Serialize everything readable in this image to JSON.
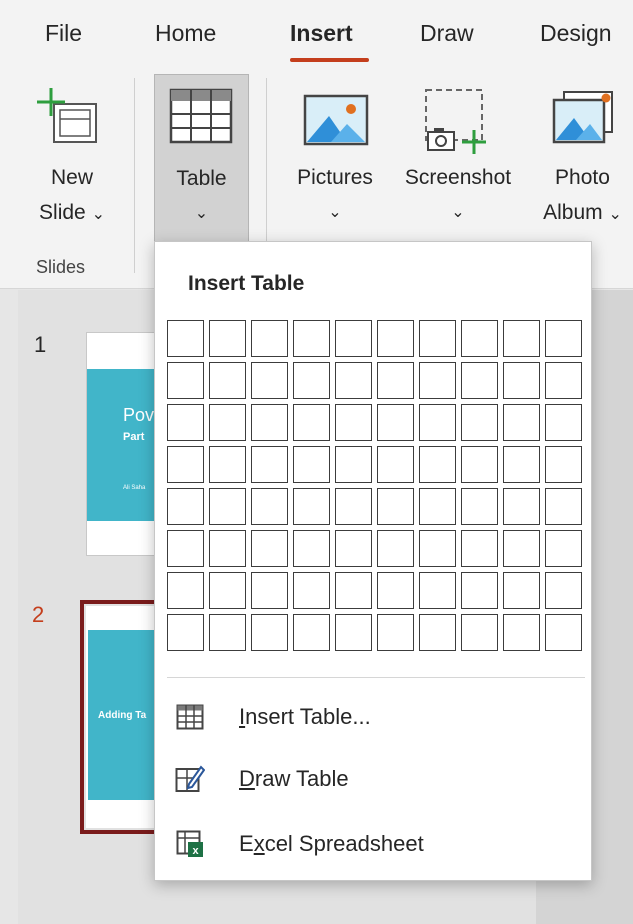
{
  "tabs": [
    {
      "label": "File"
    },
    {
      "label": "Home"
    },
    {
      "label": "Insert",
      "active": true
    },
    {
      "label": "Draw"
    },
    {
      "label": "Design"
    }
  ],
  "ribbon": {
    "new_slide": {
      "line1": "New",
      "line2": "Slide",
      "chevron": "⌄"
    },
    "table": {
      "line1": "Table",
      "chevron": "⌄"
    },
    "pictures": {
      "line1": "Pictures",
      "chevron": "⌄"
    },
    "screenshot": {
      "line1": "Screenshot",
      "chevron": "⌄"
    },
    "photo_album": {
      "line1": "Photo",
      "line2": "Album",
      "chevron": "⌄"
    },
    "group_slides": "Slides"
  },
  "slides": [
    {
      "number": "1",
      "title": "Pov",
      "subtitle": "Part",
      "author": "Ali Saha"
    },
    {
      "number": "2",
      "title": "Adding Ta",
      "selected": true
    }
  ],
  "insert_table_menu": {
    "title": "Insert Table",
    "grid": {
      "columns": 10,
      "rows": 8
    },
    "items": [
      {
        "pre": "",
        "mnemonic": "I",
        "post": "nsert Table...",
        "icon": "table-grid-icon"
      },
      {
        "pre": "",
        "mnemonic": "D",
        "post": "raw Table",
        "icon": "draw-table-pencil-icon"
      },
      {
        "pre": "E",
        "mnemonic": "x",
        "post": "cel Spreadsheet",
        "icon": "excel-sheet-icon"
      }
    ]
  },
  "colors": {
    "accent": "#c43e1c",
    "slide_band": "#41b5c9",
    "selected_slide_border": "#7a1b1b",
    "excel_green": "#1e7145"
  }
}
